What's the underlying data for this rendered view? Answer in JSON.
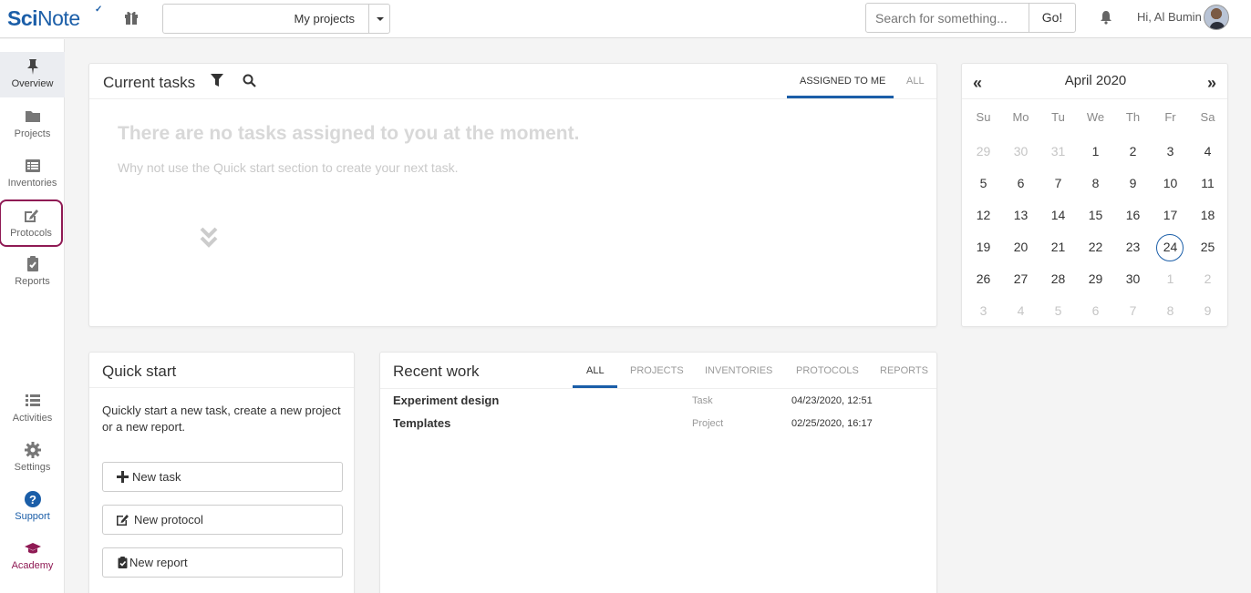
{
  "header": {
    "logo_sci": "Sci",
    "logo_note": "Note",
    "project_select": "My projects",
    "search_placeholder": "Search for something...",
    "go_label": "Go!",
    "greeting": "Hi, Al Bumin"
  },
  "sidebar": {
    "items": [
      {
        "label": "Overview",
        "icon": "pin-icon"
      },
      {
        "label": "Projects",
        "icon": "folder-icon"
      },
      {
        "label": "Inventories",
        "icon": "list-icon"
      },
      {
        "label": "Protocols",
        "icon": "edit-icon"
      },
      {
        "label": "Reports",
        "icon": "clipboard-icon"
      },
      {
        "label": "Activities",
        "icon": "activities-icon"
      },
      {
        "label": "Settings",
        "icon": "gear-icon"
      },
      {
        "label": "Support",
        "icon": "question-icon"
      },
      {
        "label": "Academy",
        "icon": "graduation-cap-icon"
      }
    ]
  },
  "tasks": {
    "title": "Current tasks",
    "tabs": [
      "ASSIGNED TO ME",
      "ALL"
    ],
    "empty_title": "There are no tasks assigned to you at the moment.",
    "empty_subtitle": "Why not use the Quick start section to create your next task."
  },
  "calendar": {
    "month": "April 2020",
    "prev": "«",
    "next": "»",
    "weekdays": [
      "Su",
      "Mo",
      "Tu",
      "We",
      "Th",
      "Fr",
      "Sa"
    ],
    "today": "24",
    "days": [
      [
        "29",
        "30",
        "31",
        "1",
        "2",
        "3",
        "4"
      ],
      [
        "5",
        "6",
        "7",
        "8",
        "9",
        "10",
        "11"
      ],
      [
        "12",
        "13",
        "14",
        "15",
        "16",
        "17",
        "18"
      ],
      [
        "19",
        "20",
        "21",
        "22",
        "23",
        "24",
        "25"
      ],
      [
        "26",
        "27",
        "28",
        "29",
        "30",
        "1",
        "2"
      ],
      [
        "3",
        "4",
        "5",
        "6",
        "7",
        "8",
        "9"
      ]
    ]
  },
  "quick_start": {
    "title": "Quick start",
    "description": "Quickly start a new task, create a new project or a new report.",
    "buttons": [
      "New task",
      "New protocol",
      "New report"
    ]
  },
  "recent_work": {
    "title": "Recent work",
    "tabs": [
      "ALL",
      "PROJECTS",
      "INVENTORIES",
      "PROTOCOLS",
      "REPORTS"
    ],
    "rows": [
      {
        "name": "Experiment design",
        "type": "Task",
        "date": "04/23/2020, 12:51"
      },
      {
        "name": "Templates",
        "type": "Project",
        "date": "02/25/2020, 16:17"
      }
    ]
  },
  "colors": {
    "accent": "#1b5ea8",
    "academy": "#8f1a54"
  }
}
